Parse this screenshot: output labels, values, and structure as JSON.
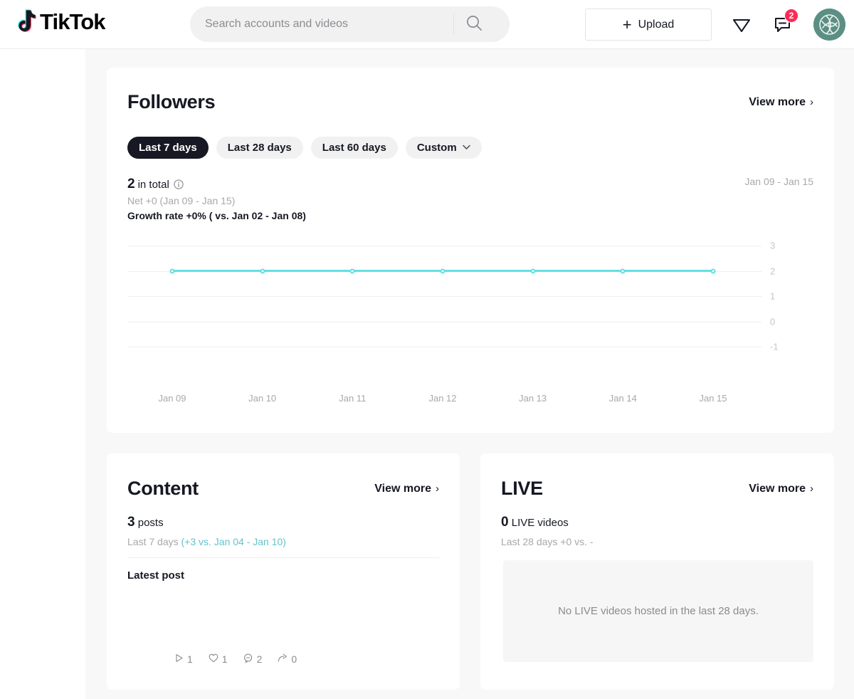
{
  "header": {
    "logo_text": "TikTok",
    "logo_icon": "tiktok-note-icon",
    "search": {
      "placeholder": "Search accounts and videos",
      "value": "",
      "icon": "search-icon"
    },
    "upload_label": "Upload",
    "upload_icon": "plus-icon",
    "send_icon": "paper-plane-icon",
    "message_icon": "message-icon",
    "message_badge": "2",
    "avatar_icon": "user-avatar",
    "badge_color": "#fe2c55"
  },
  "followers": {
    "title": "Followers",
    "view_more": "View more",
    "chevron": "›",
    "tabs": [
      {
        "label": "Last 7 days",
        "active": true
      },
      {
        "label": "Last 28 days",
        "active": false
      },
      {
        "label": "Last 60 days",
        "active": false
      },
      {
        "label": "Custom",
        "active": false,
        "caret": "⌄"
      }
    ],
    "total_value": "2",
    "total_label": "in total",
    "info_icon": "info-icon",
    "net_line": "Net +0 (Jan 09 - Jan 15)",
    "growth_line": "Growth rate +0% ( vs. Jan 02 - Jan 08)",
    "range_label": "Jan 09 - Jan 15"
  },
  "chart_data": {
    "type": "line",
    "title": "Followers",
    "xlabel": "",
    "ylabel": "",
    "categories": [
      "Jan 09",
      "Jan 10",
      "Jan 11",
      "Jan 12",
      "Jan 13",
      "Jan 14",
      "Jan 15"
    ],
    "series": [
      {
        "name": "Followers",
        "values": [
          2,
          2,
          2,
          2,
          2,
          2,
          2
        ],
        "color": "#62e0e3"
      }
    ],
    "ytick_labels": [
      "3",
      "2",
      "1",
      "0",
      "-1"
    ],
    "ylim": [
      -1,
      3
    ],
    "grid": true,
    "legend": "none",
    "marker": "circle"
  },
  "content": {
    "title": "Content",
    "view_more": "View more",
    "chevron": "›",
    "posts_value": "3",
    "posts_label": "posts",
    "period": "Last 7 days ",
    "delta": "(+3 vs. Jan 04 - Jan 10)",
    "latest_post_label": "Latest post",
    "post_stats": [
      {
        "icon": "play-icon",
        "value": "1"
      },
      {
        "icon": "heart-icon",
        "value": "1"
      },
      {
        "icon": "comment-icon",
        "value": "2"
      },
      {
        "icon": "share-icon",
        "value": "0"
      }
    ]
  },
  "live": {
    "title": "LIVE",
    "view_more": "View more",
    "chevron": "›",
    "videos_value": "0",
    "videos_label": "LIVE videos",
    "period": "Last 28 days +0 vs. -",
    "empty_message": "No LIVE videos hosted in the last 28 days."
  }
}
